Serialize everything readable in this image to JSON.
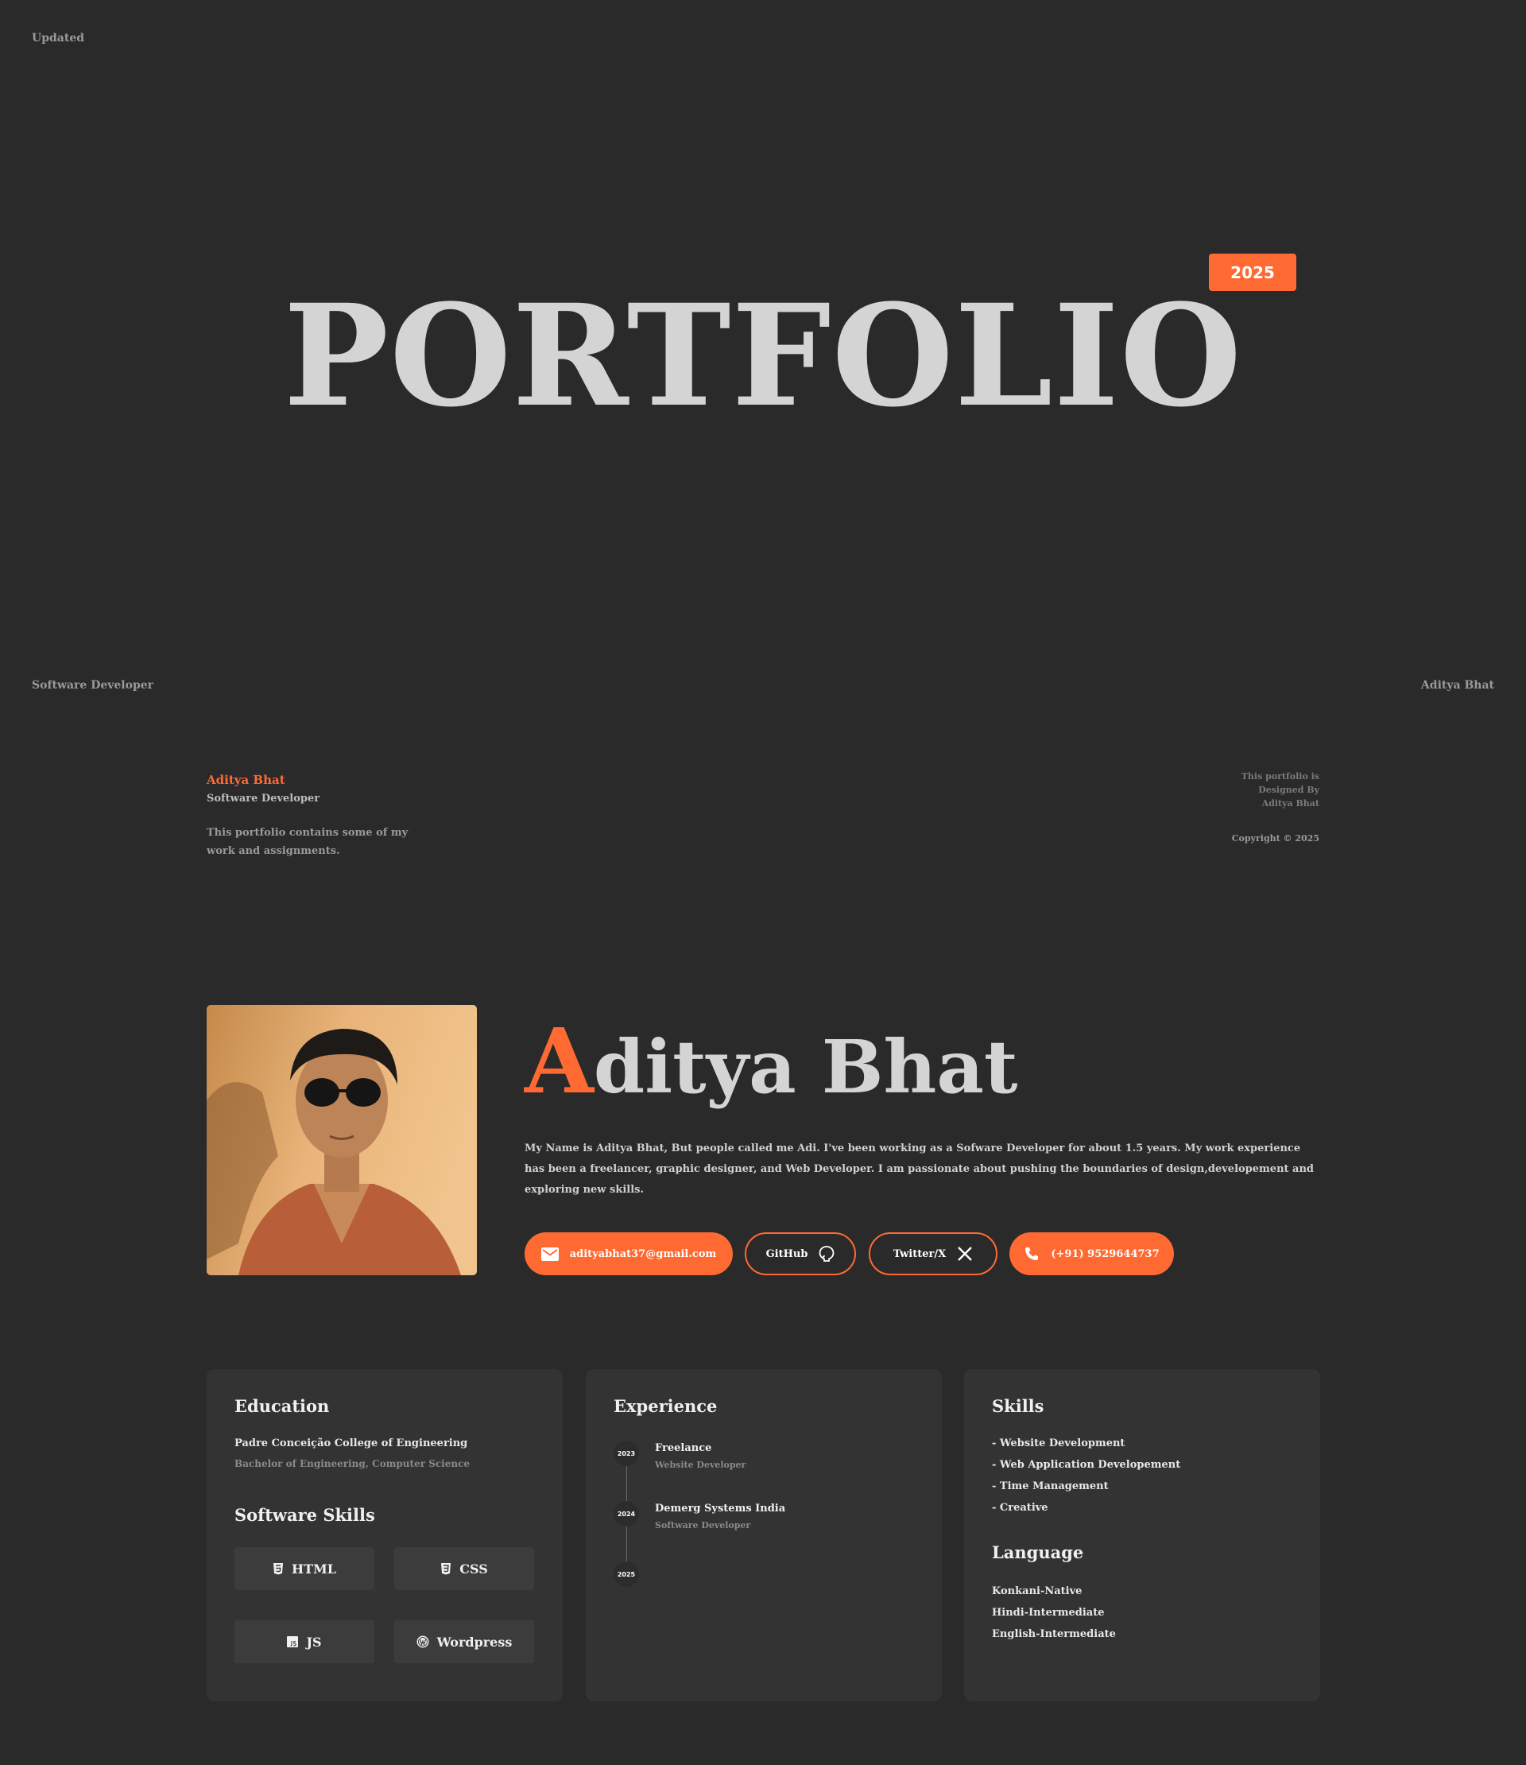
{
  "header": {
    "updated_label": "Updated",
    "year_badge": "2025",
    "title": "PORTFOLIO",
    "left_caption": "Software Developer",
    "right_caption": "Aditya Bhat"
  },
  "intro": {
    "name": "Aditya Bhat",
    "role": "Software Developer",
    "description": "This portfolio contains some of my work and assignments.",
    "credit_line1": "This portfolio is",
    "credit_line2": "Designed By",
    "credit_line3": "Aditya Bhat",
    "copyright": "Copyright © 2025"
  },
  "profile": {
    "name_initial": "A",
    "name_rest": "ditya Bhat",
    "bio": "My Name is Aditya Bhat, But people called me Adi. I've been working as a Sofware Developer for about 1.5 years. My work experience has been a freelancer, graphic designer, and Web Developer. I am passionate about pushing the boundaries of design,developement and exploring new skills."
  },
  "contacts": {
    "email": "adityabhat37@gmail.com",
    "github": "GitHub",
    "twitter": "Twitter/X",
    "phone": "(+91) 9529644737"
  },
  "education": {
    "title": "Education",
    "college": "Padre Conceição College of Engineering",
    "degree": "Bachelor of Engineering, Computer Science"
  },
  "software_skills": {
    "title": "Software Skills",
    "items": [
      "HTML",
      "CSS",
      "JS",
      "Wordpress"
    ]
  },
  "experience": {
    "title": "Experience",
    "years": [
      "2023",
      "2024",
      "2025"
    ],
    "items": [
      {
        "company": "Freelance",
        "role": "Website Developer"
      },
      {
        "company": "Demerg Systems India",
        "role": "Software Developer"
      }
    ]
  },
  "skills": {
    "title": "Skills",
    "items": [
      "Website Development",
      "Web Application Developement",
      "Time Management",
      "Creative"
    ]
  },
  "languages": {
    "title": "Language",
    "items": [
      "Konkani-Native",
      "Hindi-Intermediate",
      "English-Intermediate"
    ]
  },
  "colors": {
    "accent": "#ff6a33",
    "background": "#2a2a2a",
    "card": "#333333"
  }
}
